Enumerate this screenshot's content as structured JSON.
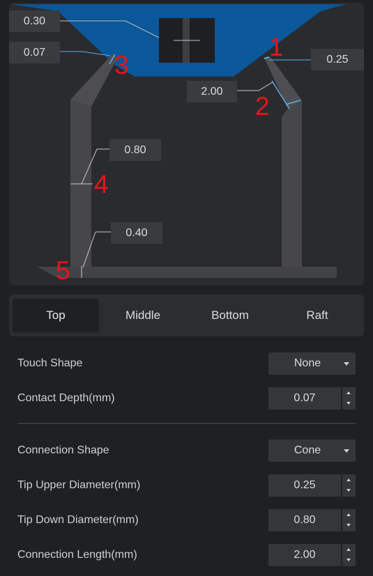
{
  "diagram": {
    "values": {
      "top_thickness": "0.30",
      "contact_depth": "0.07",
      "tip_upper": "0.25",
      "connection_length": "2.00",
      "tip_down": "0.80",
      "lower": "0.40"
    },
    "markers": [
      "1",
      "2",
      "3",
      "4",
      "5"
    ],
    "colors": {
      "model": "#0a5799",
      "support": "#4a4a4c",
      "marker": "#e8141c",
      "dimension_line": "#5ab0f0"
    }
  },
  "tabs": [
    {
      "label": "Top",
      "active": true
    },
    {
      "label": "Middle",
      "active": false
    },
    {
      "label": "Bottom",
      "active": false
    },
    {
      "label": "Raft",
      "active": false
    }
  ],
  "settings": {
    "touch_shape": {
      "label": "Touch Shape",
      "value": "None"
    },
    "contact_depth": {
      "label": "Contact Depth(mm)",
      "value": "0.07"
    },
    "connection_shape": {
      "label": "Connection Shape",
      "value": "Cone"
    },
    "tip_upper": {
      "label": "Tip Upper Diameter(mm)",
      "value": "0.25"
    },
    "tip_down": {
      "label": "Tip Down Diameter(mm)",
      "value": "0.80"
    },
    "connection_length": {
      "label": "Connection Length(mm)",
      "value": "2.00"
    }
  }
}
